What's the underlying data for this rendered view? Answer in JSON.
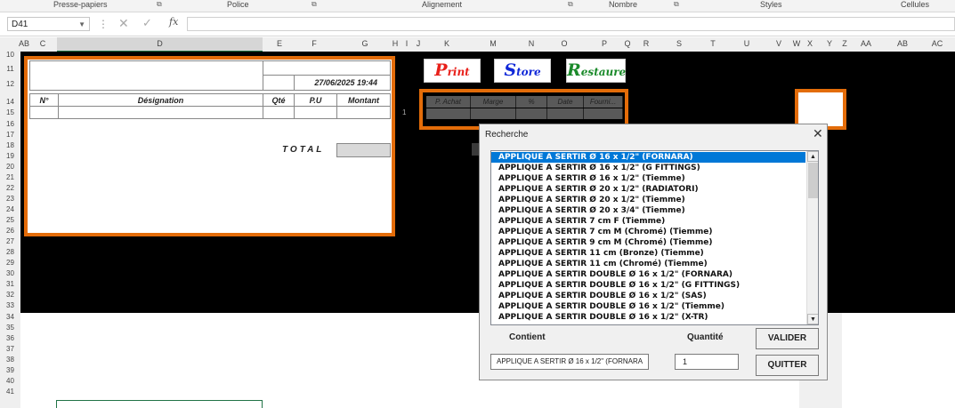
{
  "ribbon": {
    "groups": [
      "Presse-papiers",
      "Police",
      "Alignement",
      "Nombre",
      "Styles",
      "Cellules"
    ]
  },
  "formula_bar": {
    "name_box": "D41",
    "fx": "fx",
    "value": ""
  },
  "columns": [
    "AB",
    "C",
    "D",
    "E",
    "F",
    "G",
    "H",
    "I",
    "J",
    "K",
    "M",
    "N",
    "O",
    "P",
    "Q",
    "R",
    "S",
    "T",
    "U",
    "V",
    "W",
    "X",
    "Y",
    "Z",
    "AA",
    "AB",
    "AC"
  ],
  "rows": [
    "10",
    "11",
    "12",
    "14",
    "15",
    "16",
    "17",
    "18",
    "19",
    "20",
    "21",
    "22",
    "23",
    "24",
    "25",
    "26",
    "27",
    "28",
    "29",
    "30",
    "31",
    "32",
    "33",
    "34",
    "35",
    "36",
    "37",
    "38",
    "39",
    "40",
    "41"
  ],
  "invoice": {
    "date": "27/06/2025 19:44",
    "headers": [
      "N°",
      "Désignation",
      "Qté",
      "P.U",
      "Montant"
    ],
    "total_label": "TOTAL",
    "row15_index": "1"
  },
  "buttons": {
    "print": {
      "first": "P",
      "rest": "rint",
      "color": "#e8201a"
    },
    "store": {
      "first": "S",
      "rest": "tore",
      "color": "#1028d8"
    },
    "restaure": {
      "first": "R",
      "rest": "estaure",
      "color": "#1a8a2a"
    }
  },
  "achat_table": {
    "headers": [
      "P. Achat",
      "Marge",
      "%",
      "Date",
      "Fourni..."
    ]
  },
  "dialog": {
    "title": "Recherche",
    "close": "✕",
    "items": [
      "APPLIQUE A SERTIR  Ø  16 x 1/2\" (FORNARA)",
      "APPLIQUE A SERTIR  Ø  16 x 1/2\" (G FITTINGS)",
      "APPLIQUE A SERTIR  Ø  16 x 1/2\" (Tiemme)",
      "APPLIQUE A SERTIR  Ø  20 x 1/2\" (RADIATORI)",
      "APPLIQUE A SERTIR  Ø  20 x 1/2\" (Tiemme)",
      "APPLIQUE A SERTIR  Ø  20 x 3/4\" (Tiemme)",
      "APPLIQUE A SERTIR  7 cm F  (Tiemme)",
      "APPLIQUE A SERTIR  7 cm M (Chromé)  (Tiemme)",
      "APPLIQUE A SERTIR  9 cm M (Chromé)  (Tiemme)",
      "APPLIQUE A SERTIR 11 cm (Bronze)  (Tiemme)",
      "APPLIQUE A SERTIR 11 cm (Chromé)  (Tiemme)",
      "APPLIQUE A SERTIR DOUBLE  Ø 16 x 1/2\" (FORNARA)",
      "APPLIQUE A SERTIR DOUBLE  Ø 16 x 1/2\" (G FITTINGS)",
      "APPLIQUE A SERTIR DOUBLE  Ø 16 x 1/2\" (SAS)",
      "APPLIQUE A SERTIR DOUBLE  Ø 16 x 1/2\" (Tiemme)",
      "APPLIQUE A SERTIR DOUBLE  Ø 16 x 1/2\" (X-TR)"
    ],
    "selected_index": 0,
    "contient_label": "Contient",
    "quantite_label": "Quantité",
    "contient_value": "APPLIQUE A SERTIR  Ø  16 x 1/2\" (FORNARA",
    "quantite_value": "1",
    "valider_label": "VALIDER",
    "quitter_label": "QUITTER"
  }
}
